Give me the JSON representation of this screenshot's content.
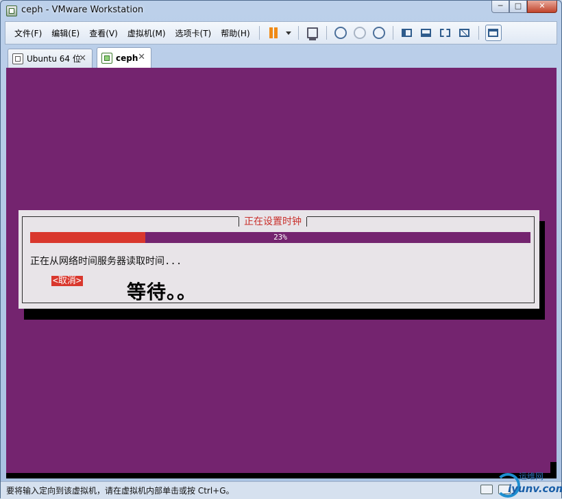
{
  "window": {
    "title": "ceph - VMware Workstation"
  },
  "menu": [
    "文件(F)",
    "编辑(E)",
    "查看(V)",
    "虚拟机(M)",
    "选项卡(T)",
    "帮助(H)"
  ],
  "tabs": [
    {
      "label": "Ubuntu 64 位",
      "active": false
    },
    {
      "label": "ceph",
      "active": true
    }
  ],
  "dialog": {
    "title": "正在设置时钟",
    "progress_percent": 23,
    "progress_text": "23%",
    "message": "正在从网络时间服务器读取时间...",
    "cancel_label": "<取消>"
  },
  "annotation": "等待。。",
  "statusbar": {
    "text": "要将输入定向到该虚拟机，请在虚拟机内部单击或按 Ctrl+G。"
  },
  "watermark": {
    "cn": "运维网",
    "en": "iyunv.com"
  },
  "colors": {
    "console": "#74246f",
    "accent_red": "#d9372d",
    "dialog_bg": "#e8e4e8"
  }
}
